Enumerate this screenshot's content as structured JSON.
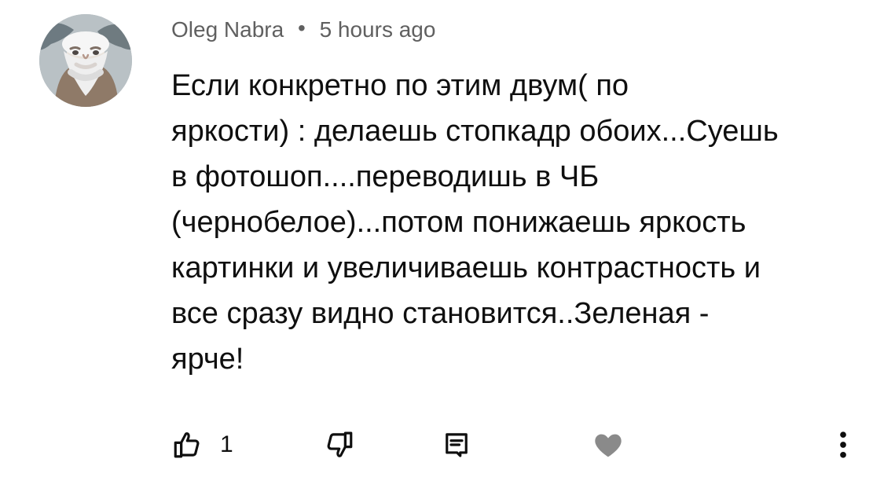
{
  "comment": {
    "author": "Oleg Nabra",
    "separator": "•",
    "timestamp": "5 hours ago",
    "text": "Если конкретно по этим двум( по\nяркости) : делаешь стопкадр обоих...Суешь\nв фотошоп....переводишь в ЧБ\n(чернобелое)...потом понижаешь яркость\nкартинки и увеличиваешь контрастность и\nвсе сразу видно становится..Зеленая -\nярче!"
  },
  "actions": {
    "like_count": "1",
    "icons": {
      "like": "thumbs-up-icon",
      "dislike": "thumbs-down-icon",
      "reply": "reply-icon",
      "heart": "heart-icon",
      "more": "more-vertical-icon"
    }
  },
  "colors": {
    "text_primary": "#0f0f0f",
    "text_secondary": "#606060",
    "icon_gray": "#7a7a7a",
    "heart_gray": "#8a8a8a"
  }
}
